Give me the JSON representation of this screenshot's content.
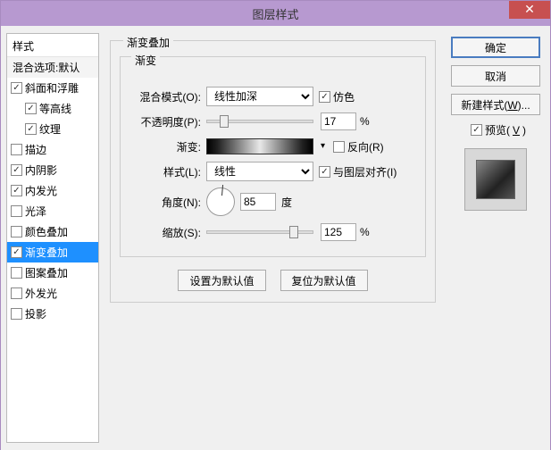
{
  "window": {
    "title": "图层样式"
  },
  "sidebar": {
    "header": "样式",
    "subheader": "混合选项:默认",
    "items": [
      {
        "label": "斜面和浮雕",
        "checked": true,
        "indent": false,
        "selected": false,
        "name": "bevel"
      },
      {
        "label": "等高线",
        "checked": true,
        "indent": true,
        "selected": false,
        "name": "contour"
      },
      {
        "label": "纹理",
        "checked": true,
        "indent": true,
        "selected": false,
        "name": "texture"
      },
      {
        "label": "描边",
        "checked": false,
        "indent": false,
        "selected": false,
        "name": "stroke"
      },
      {
        "label": "内阴影",
        "checked": true,
        "indent": false,
        "selected": false,
        "name": "inner-shadow"
      },
      {
        "label": "内发光",
        "checked": true,
        "indent": false,
        "selected": false,
        "name": "inner-glow"
      },
      {
        "label": "光泽",
        "checked": false,
        "indent": false,
        "selected": false,
        "name": "satin"
      },
      {
        "label": "颜色叠加",
        "checked": false,
        "indent": false,
        "selected": false,
        "name": "color-overlay"
      },
      {
        "label": "渐变叠加",
        "checked": true,
        "indent": false,
        "selected": true,
        "name": "gradient-overlay"
      },
      {
        "label": "图案叠加",
        "checked": false,
        "indent": false,
        "selected": false,
        "name": "pattern-overlay"
      },
      {
        "label": "外发光",
        "checked": false,
        "indent": false,
        "selected": false,
        "name": "outer-glow"
      },
      {
        "label": "投影",
        "checked": false,
        "indent": false,
        "selected": false,
        "name": "drop-shadow"
      }
    ]
  },
  "panel": {
    "title": "渐变叠加",
    "section": "渐变",
    "blend_label": "混合模式(O):",
    "blend_value": "线性加深",
    "dither_label": "仿色",
    "opacity_label": "不透明度(P):",
    "opacity_value": "17",
    "pct": "%",
    "gradient_label": "渐变:",
    "reverse_label": "反向(R)",
    "style_label": "样式(L):",
    "style_value": "线性",
    "align_label": "与图层对齐(I)",
    "angle_label": "角度(N):",
    "angle_value": "85",
    "deg": "度",
    "scale_label": "缩放(S):",
    "scale_value": "125",
    "default_btn": "设置为默认值",
    "reset_btn": "复位为默认值"
  },
  "right": {
    "ok": "确定",
    "cancel": "取消",
    "newstyle": "新建样式(W)...",
    "preview": "预览(V)"
  }
}
